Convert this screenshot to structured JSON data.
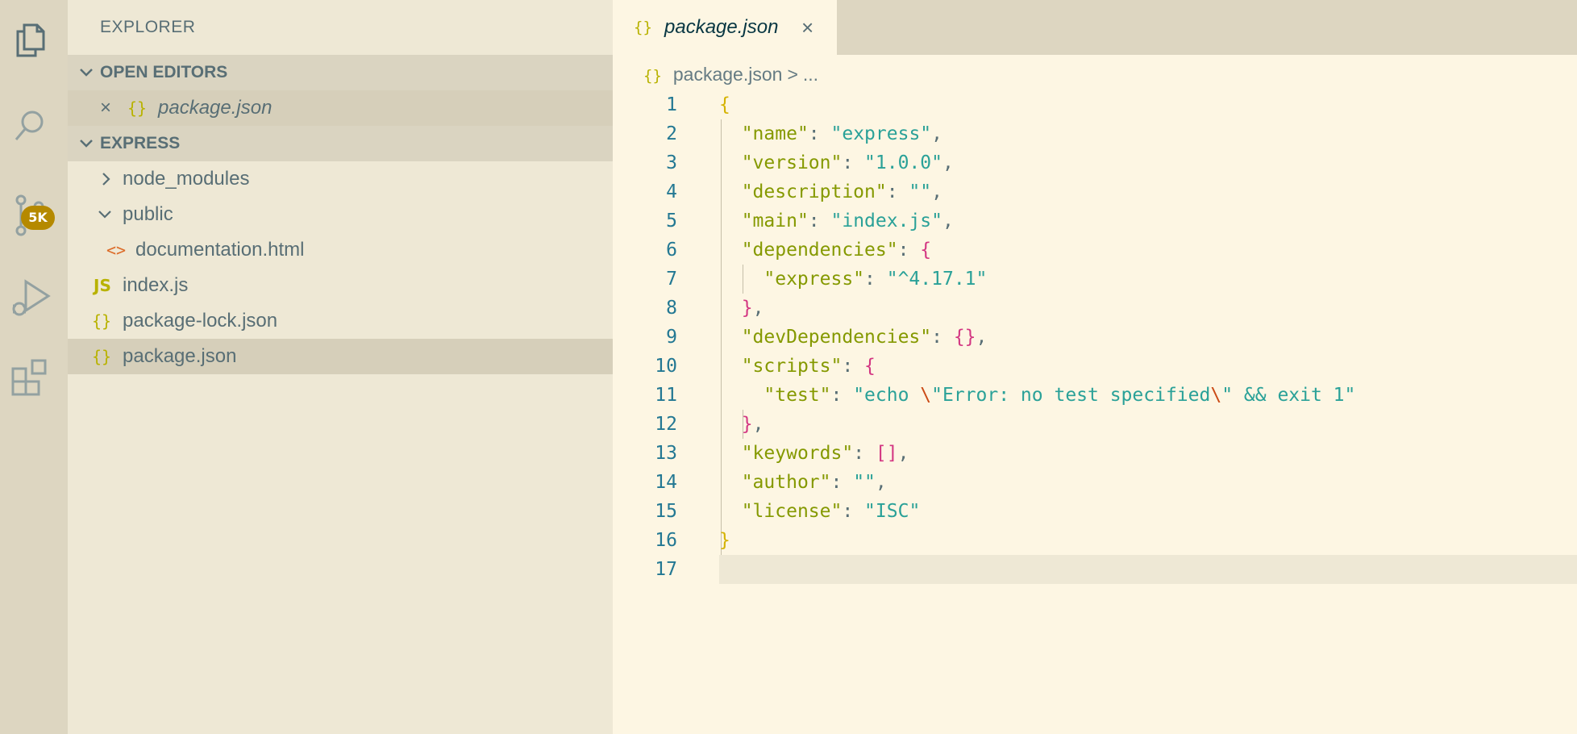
{
  "activity_bar": {
    "items": [
      {
        "name": "explorer-icon"
      },
      {
        "name": "search-icon"
      },
      {
        "name": "source-control-icon"
      },
      {
        "name": "run-debug-icon"
      },
      {
        "name": "extensions-icon"
      }
    ],
    "source_control_badge": "5K"
  },
  "sidebar": {
    "title": "EXPLORER",
    "open_editors": {
      "label": "OPEN EDITORS",
      "items": [
        {
          "close": "×",
          "icon": "{}",
          "label": "package.json"
        }
      ]
    },
    "project": {
      "label": "EXPRESS",
      "items": [
        {
          "type": "folder",
          "chevron": "›",
          "label": "node_modules",
          "expanded": false
        },
        {
          "type": "folder",
          "chevron": "⌄",
          "label": "public",
          "expanded": true
        },
        {
          "type": "html",
          "icon": "<>",
          "label": "documentation.html"
        },
        {
          "type": "js",
          "icon": "JS",
          "label": "index.js"
        },
        {
          "type": "json",
          "icon": "{}",
          "label": "package-lock.json"
        },
        {
          "type": "json",
          "icon": "{}",
          "label": "package.json",
          "selected": true
        }
      ]
    }
  },
  "editor": {
    "tab": {
      "icon": "{}",
      "label": "package.json",
      "close": "×"
    },
    "breadcrumb": {
      "icon": "{}",
      "file": "package.json",
      "separator": ">",
      "rest": "..."
    },
    "line_numbers": [
      "1",
      "2",
      "3",
      "4",
      "5",
      "6",
      "7",
      "8",
      "9",
      "10",
      "11",
      "12",
      "13",
      "14",
      "15",
      "16",
      "17"
    ],
    "current_line": "17",
    "json": {
      "name": "express",
      "version": "1.0.0",
      "description": "",
      "main": "index.js",
      "dependencies": {
        "express": "^4.17.1"
      },
      "devDependencies": "{}",
      "scripts": {
        "test_prefix": "echo ",
        "test_esc1": "\\",
        "test_mid": "\"Error: no test specified",
        "test_esc2": "\\",
        "test_suffix": "\" && exit 1"
      },
      "keywords": "[]",
      "author": "",
      "license": "ISC"
    }
  },
  "colors": {
    "background": "#fdf6e3",
    "sidebar": "#eee8d5",
    "activity_bar": "#ddd6c1",
    "badge": "#b58900",
    "key": "#859900",
    "string": "#2aa198",
    "bracket": "#d33682",
    "brace": "#d4b200"
  }
}
